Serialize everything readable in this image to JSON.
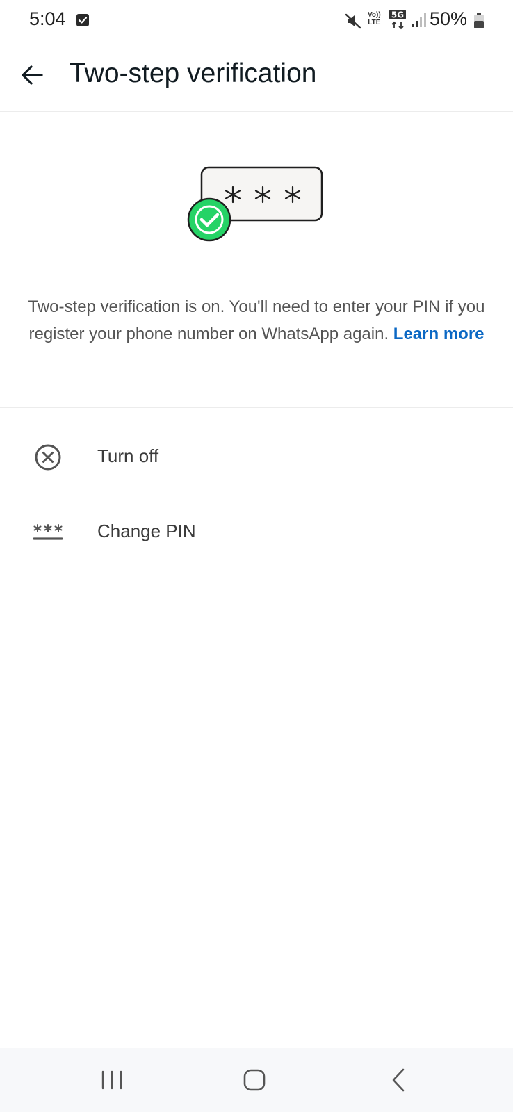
{
  "status_bar": {
    "time": "5:04",
    "volte_line1": "Vo))",
    "volte_line2": "LTE",
    "network": "5G",
    "battery": "50%"
  },
  "app_bar": {
    "title": "Two-step verification"
  },
  "info": {
    "text": "Two-step verification is on. You'll need to enter your PIN if you register your phone number on WhatsApp again.",
    "link": "Learn more"
  },
  "menu": {
    "turn_off": "Turn off",
    "change_pin": "Change PIN"
  },
  "icons": {
    "back": "arrow-left-icon",
    "turn_off": "circle-x-icon",
    "change_pin": "asterisk-pin-icon",
    "illustration": "pin-check-illustration"
  },
  "colors": {
    "accent_green": "#25d366",
    "link_blue": "#0b68c4",
    "text_primary": "#111b21",
    "text_secondary": "#545454"
  }
}
